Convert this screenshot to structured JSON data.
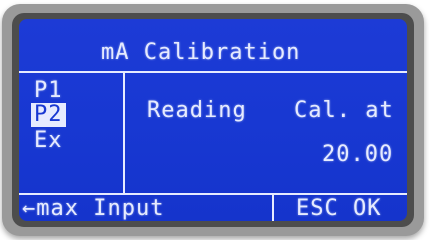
{
  "display": {
    "title": "mA Calibration",
    "menu": {
      "items": [
        {
          "label": "P1",
          "selected": false
        },
        {
          "label": "P2",
          "selected": true
        },
        {
          "label": "Ex",
          "selected": false
        }
      ]
    },
    "columns": {
      "reading_label": "Reading",
      "cal_label": "Cal. at",
      "cal_value": "20.00"
    },
    "footer": {
      "left_text": "←max Input",
      "right_text": "ESC OK"
    }
  },
  "colors": {
    "lcd_background": "#1838d2",
    "lcd_text": "#e6ebff",
    "bezel": "#4d4d4d",
    "frame": "#9a9a9a"
  }
}
